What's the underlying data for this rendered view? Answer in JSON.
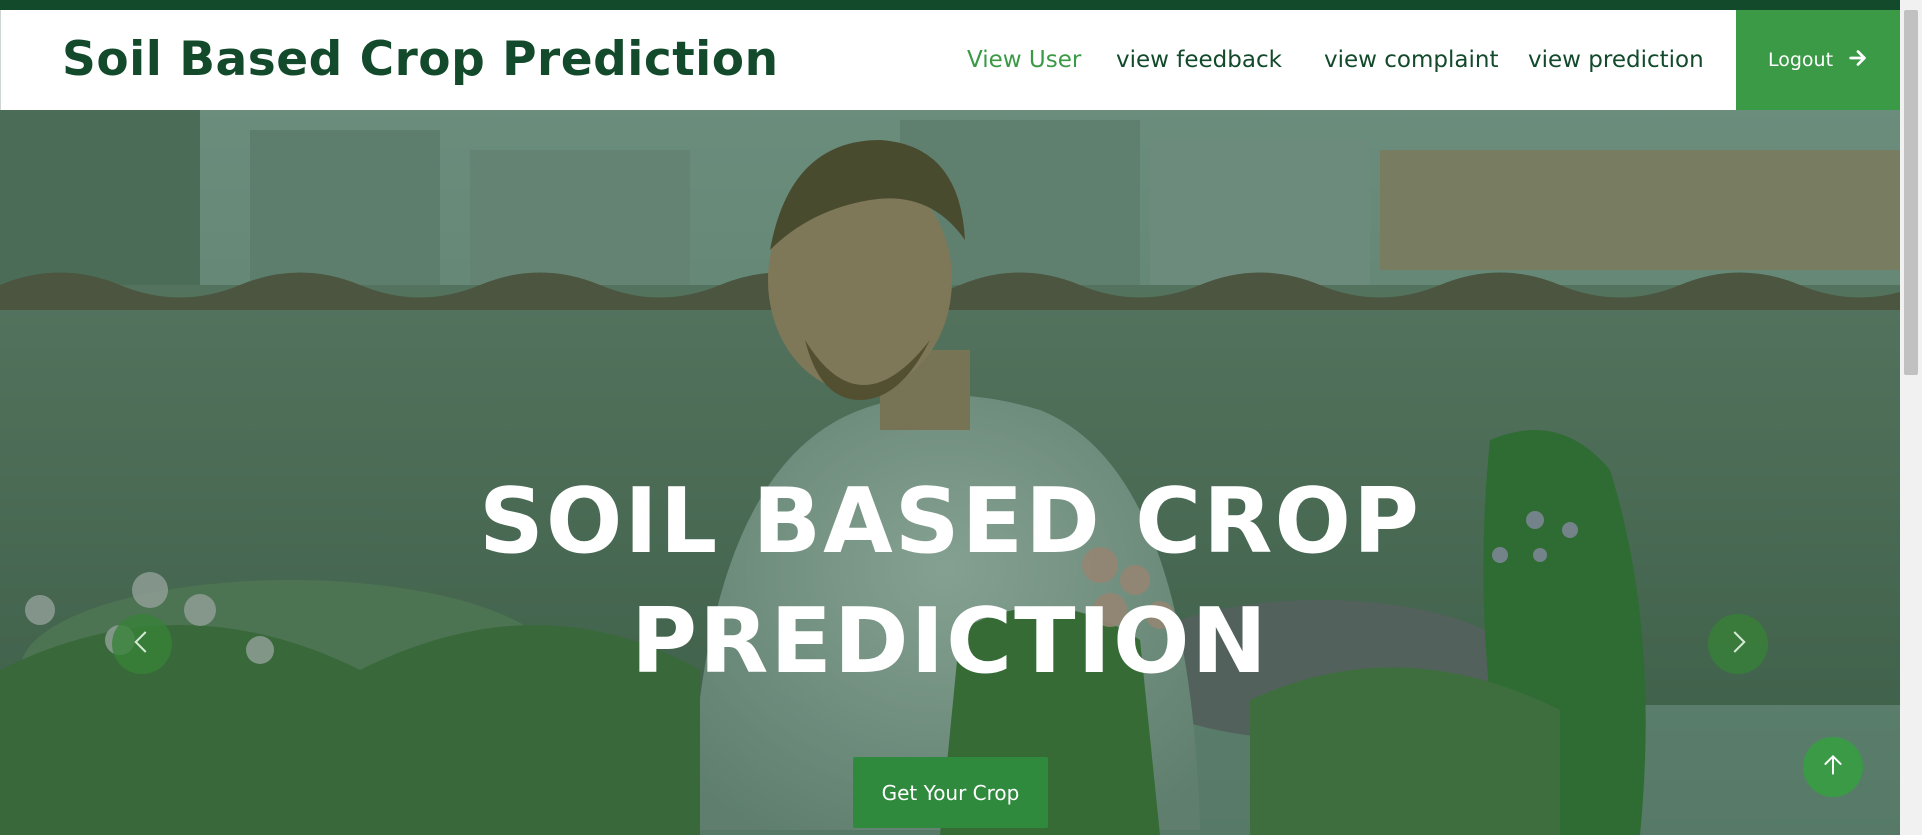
{
  "navbar": {
    "brand": "Soil Based Crop Prediction",
    "links": [
      {
        "label": "View User",
        "active": true
      },
      {
        "label": "view feedback",
        "active": false
      },
      {
        "label": "view complaint",
        "active": false
      },
      {
        "label": "view prediction",
        "active": false
      }
    ],
    "logout_label": "Logout",
    "logout_icon": "arrow-right-icon"
  },
  "hero": {
    "title_line1": "SOIL BASED CROP",
    "title_line2": "PREDICTION",
    "cta_label": "Get Your Crop",
    "prev_icon": "chevron-left-icon",
    "next_icon": "chevron-right-icon"
  },
  "back_to_top_icon": "arrow-up-icon",
  "colors": {
    "brand_dark_green": "#124a2b",
    "accent_green": "#3b9a46",
    "cta_green": "#2f8a3e"
  }
}
